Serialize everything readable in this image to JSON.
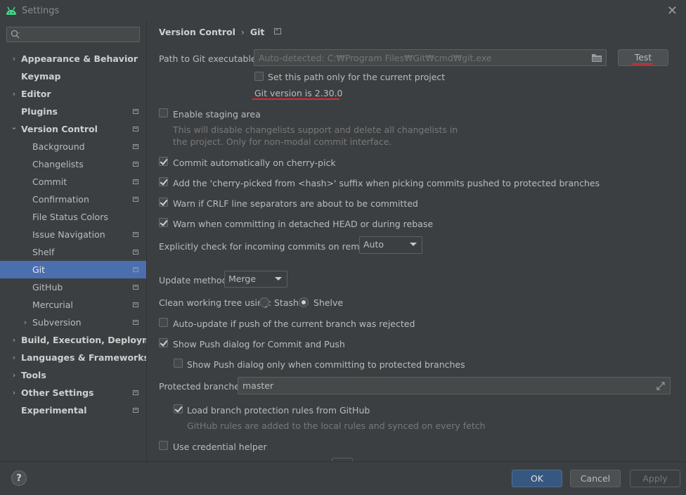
{
  "window": {
    "title": "Settings"
  },
  "search": {
    "placeholder": ""
  },
  "sidebar": {
    "items": [
      {
        "label": "Appearance & Behavior",
        "level": 0,
        "arrow": "›",
        "bold": true,
        "pin": false
      },
      {
        "label": "Keymap",
        "level": 0,
        "arrow": "",
        "bold": true,
        "pin": false
      },
      {
        "label": "Editor",
        "level": 0,
        "arrow": "›",
        "bold": true,
        "pin": false
      },
      {
        "label": "Plugins",
        "level": 0,
        "arrow": "",
        "bold": true,
        "pin": true
      },
      {
        "label": "Version Control",
        "level": 0,
        "arrow": "⌄",
        "bold": true,
        "pin": true
      },
      {
        "label": "Background",
        "level": 1,
        "arrow": "",
        "bold": false,
        "pin": true
      },
      {
        "label": "Changelists",
        "level": 1,
        "arrow": "",
        "bold": false,
        "pin": true
      },
      {
        "label": "Commit",
        "level": 1,
        "arrow": "",
        "bold": false,
        "pin": true
      },
      {
        "label": "Confirmation",
        "level": 1,
        "arrow": "",
        "bold": false,
        "pin": true
      },
      {
        "label": "File Status Colors",
        "level": 1,
        "arrow": "",
        "bold": false,
        "pin": false
      },
      {
        "label": "Issue Navigation",
        "level": 1,
        "arrow": "",
        "bold": false,
        "pin": true
      },
      {
        "label": "Shelf",
        "level": 1,
        "arrow": "",
        "bold": false,
        "pin": true
      },
      {
        "label": "Git",
        "level": 1,
        "arrow": "",
        "bold": false,
        "pin": true,
        "selected": true
      },
      {
        "label": "GitHub",
        "level": 1,
        "arrow": "",
        "bold": false,
        "pin": true
      },
      {
        "label": "Mercurial",
        "level": 1,
        "arrow": "",
        "bold": false,
        "pin": true
      },
      {
        "label": "Subversion",
        "level": 1,
        "arrow": "›",
        "bold": false,
        "pin": true
      },
      {
        "label": "Build, Execution, Deployment",
        "level": 0,
        "arrow": "›",
        "bold": true,
        "pin": false
      },
      {
        "label": "Languages & Frameworks",
        "level": 0,
        "arrow": "›",
        "bold": true,
        "pin": false
      },
      {
        "label": "Tools",
        "level": 0,
        "arrow": "›",
        "bold": true,
        "pin": false
      },
      {
        "label": "Other Settings",
        "level": 0,
        "arrow": "›",
        "bold": true,
        "pin": true
      },
      {
        "label": "Experimental",
        "level": 0,
        "arrow": "",
        "bold": true,
        "pin": true
      }
    ]
  },
  "breadcrumb": {
    "parent": "Version Control",
    "separator": "›",
    "current": "Git"
  },
  "git": {
    "path_label": "Path to Git executable:",
    "path_placeholder": "Auto-detected: C:₩Program Files₩Git₩cmd₩git.exe",
    "test_button": "Test",
    "project_only_label": "Set this path only for the current project",
    "project_only_checked": false,
    "version_text": "Git version is 2.30.0",
    "staging_label": "Enable staging area",
    "staging_checked": false,
    "staging_desc_1": "This will disable changelists support and delete all changelists in",
    "staging_desc_2": "the project. Only for non-modal commit interface.",
    "cherry_pick_label": "Commit automatically on cherry-pick",
    "cherry_pick_checked": true,
    "cherry_suffix_label": "Add the 'cherry-picked from <hash>' suffix when picking commits pushed to protected branches",
    "cherry_suffix_checked": true,
    "crlf_label": "Warn if CRLF line separators are about to be committed",
    "crlf_checked": true,
    "detached_label": "Warn when committing in detached HEAD or during rebase",
    "detached_checked": true,
    "incoming_label": "Explicitly check for incoming commits on remotes:",
    "incoming_value": "Auto",
    "update_label": "Update method:",
    "update_value": "Merge",
    "clean_label": "Clean working tree using:",
    "stash_label": "Stash",
    "shelve_label": "Shelve",
    "clean_selected": "Shelve",
    "auto_update_label": "Auto-update if push of the current branch was rejected",
    "auto_update_checked": false,
    "show_push_label": "Show Push dialog for Commit and Push",
    "show_push_checked": true,
    "show_push_protected_label": "Show Push dialog only when committing to protected branches",
    "show_push_protected_checked": false,
    "protected_label": "Protected branches:",
    "protected_value": "master",
    "load_rules_label": "Load branch protection rules from GitHub",
    "load_rules_checked": true,
    "load_rules_desc": "GitHub rules are added to the local rules and synced on every fetch",
    "credential_label": "Use credential helper",
    "credential_checked": false
  },
  "footer": {
    "help": "?",
    "ok": "OK",
    "cancel": "Cancel",
    "apply": "Apply"
  },
  "colors": {
    "background": "#3c3f41",
    "selection": "#4b6eaf",
    "accent_ok": "#365880",
    "annotation_red": "#e0282f"
  }
}
